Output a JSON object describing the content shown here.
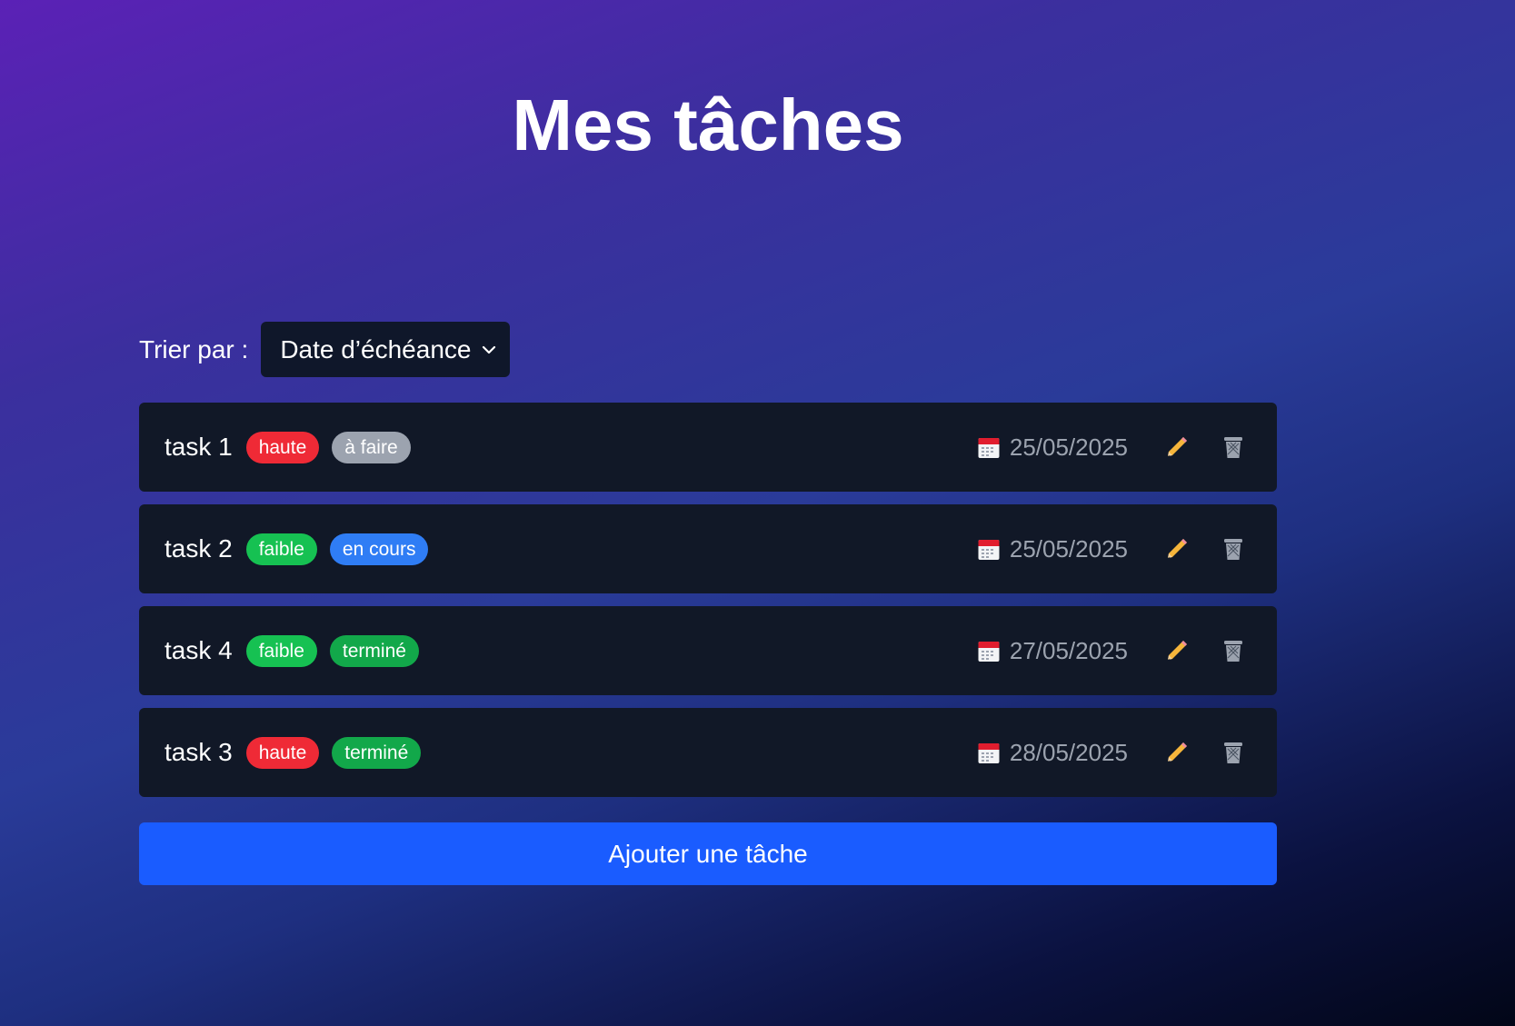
{
  "title": "Mes tâches",
  "sort": {
    "label": "Trier par :",
    "selected": "Date d’échéance"
  },
  "colors": {
    "haute": "#ef2a36",
    "faible": "#16c152",
    "a_faire": "#9ca3af",
    "en_cours": "#2f7df5",
    "termine": "#12a84a",
    "add_button": "#1a5cff",
    "card": "#111827"
  },
  "tasks": [
    {
      "name": "task 1",
      "priority": "haute",
      "priority_color": "#ef2a36",
      "status": "à faire",
      "status_color": "#9ca3af",
      "date": "25/05/2025"
    },
    {
      "name": "task 2",
      "priority": "faible",
      "priority_color": "#16c152",
      "status": "en cours",
      "status_color": "#2f7df5",
      "date": "25/05/2025"
    },
    {
      "name": "task 4",
      "priority": "faible",
      "priority_color": "#16c152",
      "status": "terminé",
      "status_color": "#12a84a",
      "date": "27/05/2025"
    },
    {
      "name": "task 3",
      "priority": "haute",
      "priority_color": "#ef2a36",
      "status": "terminé",
      "status_color": "#12a84a",
      "date": "28/05/2025"
    }
  ],
  "icons": {
    "date": "calendar-icon",
    "edit": "pencil-icon",
    "delete": "trash-icon"
  },
  "add_button": {
    "label": "Ajouter une tâche"
  }
}
